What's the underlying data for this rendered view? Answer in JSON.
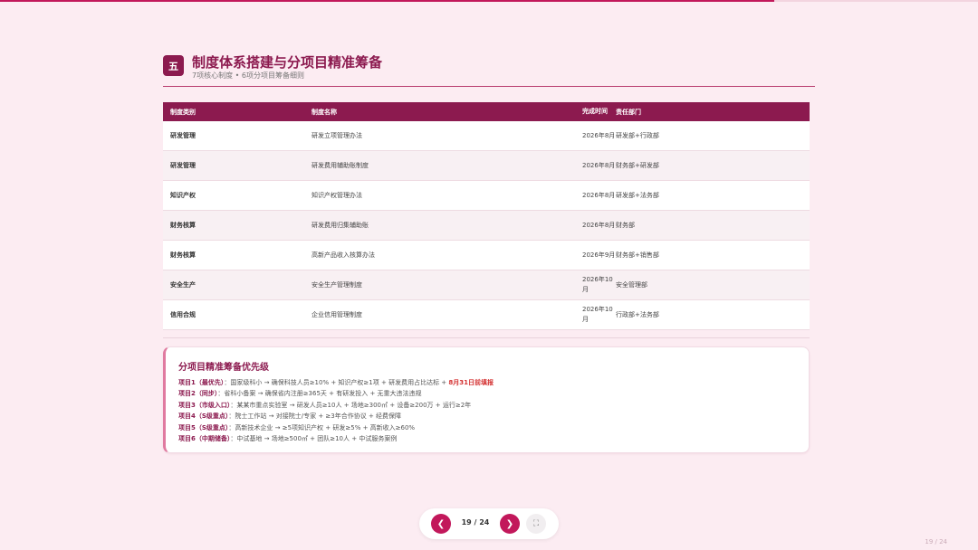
{
  "progress": {
    "fraction": 0.7917,
    "color": "#c2185b"
  },
  "header": {
    "badge": "五",
    "title": "制度体系搭建与分项目精准筹备",
    "subtitle": "7项核心制度 • 6项分项目筹备细则"
  },
  "table": {
    "headers": [
      "制度类别",
      "制度名称",
      "完成时间",
      "责任部门"
    ],
    "rows": [
      [
        "研发管理",
        "研发立项管理办法",
        "2026年8月",
        "研发部+行政部"
      ],
      [
        "研发管理",
        "研发费用辅助账制度",
        "2026年8月",
        "财务部+研发部"
      ],
      [
        "知识产权",
        "知识产权管理办法",
        "2026年8月",
        "研发部+法务部"
      ],
      [
        "财务核算",
        "研发费用归集辅助账",
        "2026年8月",
        "财务部"
      ],
      [
        "财务核算",
        "高新产品收入核算办法",
        "2026年9月",
        "财务部+销售部"
      ],
      [
        "安全生产",
        "安全生产管理制度",
        "2026年10月",
        "安全管理部"
      ],
      [
        "信用合规",
        "企业信用管理制度",
        "2026年10月",
        "行政部+法务部"
      ]
    ]
  },
  "priority": {
    "title": "分项目精准筹备优先级",
    "items": [
      {
        "label": "项目1（最优先）",
        "text": "国家级科小 → 确保科技人员≥10% + 知识产权≥1项 + 研发费用占比达标 + ",
        "highlight": "8月31日前填报"
      },
      {
        "label": "项目2（同步）",
        "text": "省科小备案 → 确保省内注册≥365天 + 有研发投入 + 无重大违法违规",
        "highlight": ""
      },
      {
        "label": "项目3（市级入口）",
        "text": "某某市重点实验室 → 研发人员≥10人 + 场地≥300㎡ + 设备≥200万 + 运行≥2年",
        "highlight": ""
      },
      {
        "label": "项目4（S级重点）",
        "text": "院士工作站 → 对接院士/专家 + ≥3年合作协议 + 经费保障",
        "highlight": ""
      },
      {
        "label": "项目5（S级重点）",
        "text": "高新技术企业 → ≥5项知识产权 + 研发≥5% + 高新收入≥60%",
        "highlight": ""
      },
      {
        "label": "项目6（中期储备）",
        "text": "中试基地 → 场地≥500㎡ + 团队≥10人 + 中试服务案例",
        "highlight": ""
      }
    ]
  },
  "pager": {
    "prev_icon": "❮",
    "next_icon": "❯",
    "fullscreen_icon": "⛶",
    "indicator": "19 / 24"
  },
  "corner_page": "19 / 24"
}
